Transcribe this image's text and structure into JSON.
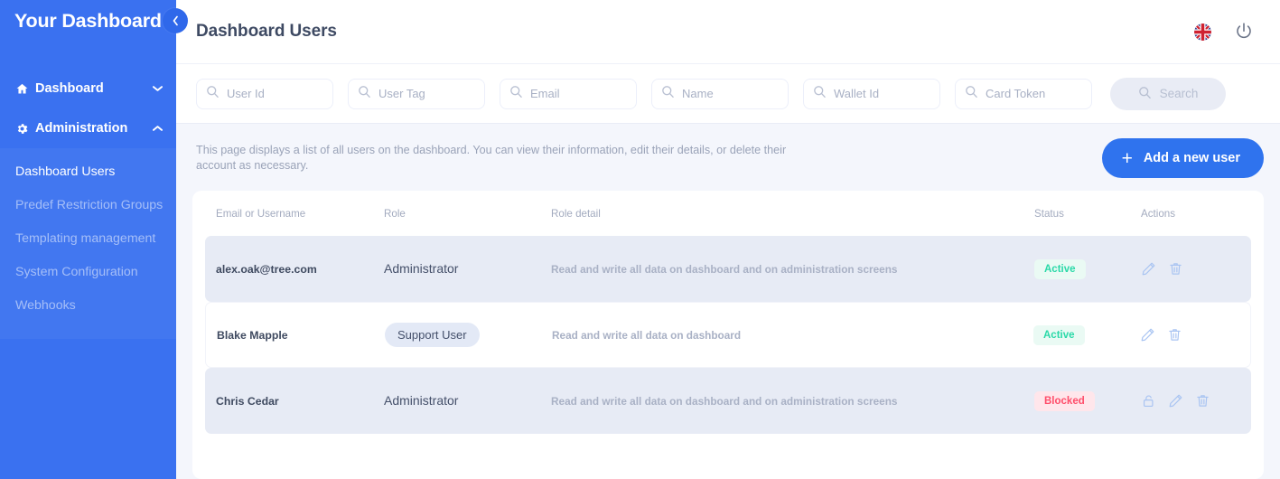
{
  "sidebar": {
    "brand": "Your Dashboard",
    "collapse_icon": "chevron-left-icon",
    "groups": [
      {
        "label": "Dashboard",
        "icon": "home-icon",
        "chevron": "chevron-down-icon",
        "expanded": false
      },
      {
        "label": "Administration",
        "icon": "gear-icon",
        "chevron": "chevron-up-icon",
        "expanded": true
      }
    ],
    "items": [
      {
        "label": "Dashboard Users",
        "active": true
      },
      {
        "label": "Predef Restriction Groups",
        "active": false
      },
      {
        "label": "Templating management",
        "active": false
      },
      {
        "label": "System Configuration",
        "active": false
      },
      {
        "label": "Webhooks",
        "active": false
      }
    ]
  },
  "topbar": {
    "title": "Dashboard Users",
    "language_icon": "uk-flag-icon",
    "power_icon": "power-icon"
  },
  "filters": {
    "fields": [
      {
        "name": "user-id",
        "placeholder": "User Id",
        "value": ""
      },
      {
        "name": "user-tag",
        "placeholder": "User Tag",
        "value": ""
      },
      {
        "name": "email",
        "placeholder": "Email",
        "value": ""
      },
      {
        "name": "name",
        "placeholder": "Name",
        "value": ""
      },
      {
        "name": "wallet-id",
        "placeholder": "Wallet Id",
        "value": ""
      },
      {
        "name": "card-token",
        "placeholder": "Card Token",
        "value": ""
      }
    ],
    "search_label": "Search",
    "search_icon": "search-icon",
    "search_disabled": true
  },
  "description": "This page displays a list of all users on the dashboard. You can view their information, edit their details, or delete their account as necessary.",
  "add_button": {
    "label": "Add a new user",
    "icon": "plus-icon"
  },
  "table": {
    "headers": {
      "email": "Email or Username",
      "role": "Role",
      "detail": "Role detail",
      "status": "Status",
      "actions": "Actions"
    },
    "rows": [
      {
        "email": "alex.oak@tree.com",
        "role": "Administrator",
        "role_is_chip": false,
        "detail": "Read and write all data on dashboard and on administration screens",
        "status": "Active",
        "status_kind": "active",
        "highlight": true,
        "actions": [
          "edit-icon",
          "delete-icon"
        ]
      },
      {
        "email": "Blake Mapple",
        "role": "Support User",
        "role_is_chip": true,
        "detail": "Read and write all data on dashboard",
        "status": "Active",
        "status_kind": "active",
        "highlight": false,
        "actions": [
          "edit-icon",
          "delete-icon"
        ]
      },
      {
        "email": "Chris Cedar",
        "role": "Administrator",
        "role_is_chip": false,
        "detail": "Read and write all data on dashboard and on administration screens",
        "status": "Blocked",
        "status_kind": "blocked",
        "highlight": true,
        "actions": [
          "unlock-icon",
          "edit-icon",
          "delete-icon"
        ]
      }
    ]
  },
  "colors": {
    "brand_blue": "#3a71f0",
    "button_blue": "#2f73ee",
    "page_bg": "#f4f6fc",
    "row_highlight": "#e7ebf5",
    "active_green": "#2ad9a8",
    "blocked_red": "#ff4d6a"
  }
}
